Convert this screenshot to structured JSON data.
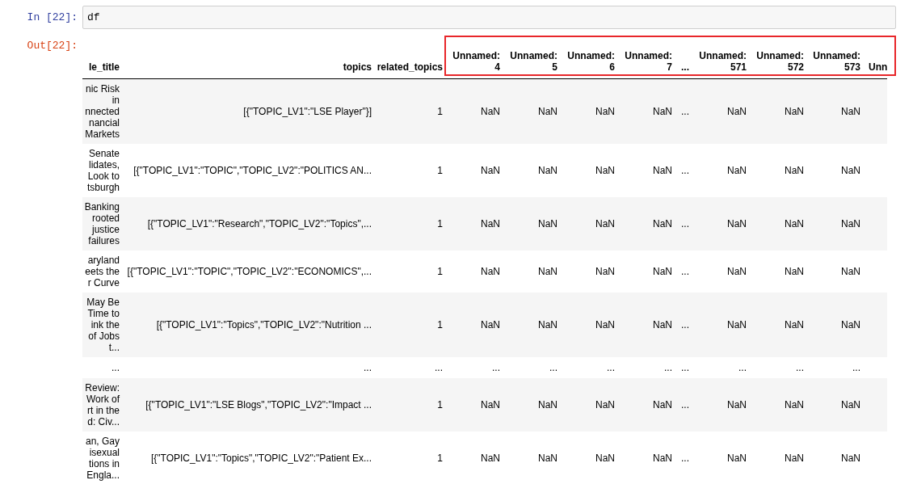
{
  "input_cell": {
    "prompt": "In [22]:",
    "code": "df"
  },
  "output_cell": {
    "prompt": "Out[22]:",
    "header_highlight": true,
    "table": {
      "columns": [
        "le_title",
        "topics",
        "related_topics",
        "Unnamed: 4",
        "Unnamed: 5",
        "Unnamed: 6",
        "Unnamed: 7",
        "...",
        "Unnamed: 571",
        "Unnamed: 572",
        "Unnamed: 573",
        "Unn"
      ],
      "rows": [
        {
          "cells": [
            "nic Risk\nin\nnnected\nnancial\nMarkets",
            "[{\"TOPIC_LV1\":\"LSE Player\"}]",
            "1",
            "NaN",
            "NaN",
            "NaN",
            "NaN",
            "...",
            "NaN",
            "NaN",
            "NaN"
          ]
        },
        {
          "cells": [
            "Senate\nlidates,\nLook to\ntsburgh",
            "[{\"TOPIC_LV1\":\"TOPIC\",\"TOPIC_LV2\":\"POLITICS AN...",
            "1",
            "NaN",
            "NaN",
            "NaN",
            "NaN",
            "...",
            "NaN",
            "NaN",
            "NaN"
          ]
        },
        {
          "cells": [
            "Banking\nrooted\njustice\nfailures",
            "[{\"TOPIC_LV1\":\"Research\",\"TOPIC_LV2\":\"Topics\",...",
            "1",
            "NaN",
            "NaN",
            "NaN",
            "NaN",
            "...",
            "NaN",
            "NaN",
            "NaN"
          ]
        },
        {
          "cells": [
            "aryland\neets the\nr Curve",
            "[{\"TOPIC_LV1\":\"TOPIC\",\"TOPIC_LV2\":\"ECONOMICS\",...",
            "1",
            "NaN",
            "NaN",
            "NaN",
            "NaN",
            "...",
            "NaN",
            "NaN",
            "NaN"
          ]
        },
        {
          "cells": [
            "May Be\nTime to\nink the\nof Jobs\nt...",
            "[{\"TOPIC_LV1\":\"Topics\",\"TOPIC_LV2\":\"Nutrition ...",
            "1",
            "NaN",
            "NaN",
            "NaN",
            "NaN",
            "...",
            "NaN",
            "NaN",
            "NaN"
          ]
        },
        {
          "cells": [
            "...",
            "...",
            "...",
            "...",
            "...",
            "...",
            "...",
            "...",
            "...",
            "...",
            "..."
          ]
        },
        {
          "cells": [
            "Review:\nWork of\nrt in the\nd: Civ...",
            "[{\"TOPIC_LV1\":\"LSE Blogs\",\"TOPIC_LV2\":\"Impact ...",
            "1",
            "NaN",
            "NaN",
            "NaN",
            "NaN",
            "...",
            "NaN",
            "NaN",
            "NaN"
          ]
        },
        {
          "cells": [
            "an, Gay\nisexual\ntions in\nEngla...",
            "[{\"TOPIC_LV1\":\"Topics\",\"TOPIC_LV2\":\"Patient Ex...",
            "1",
            "NaN",
            "NaN",
            "NaN",
            "NaN",
            "...",
            "NaN",
            "NaN",
            "NaN"
          ]
        }
      ]
    }
  }
}
